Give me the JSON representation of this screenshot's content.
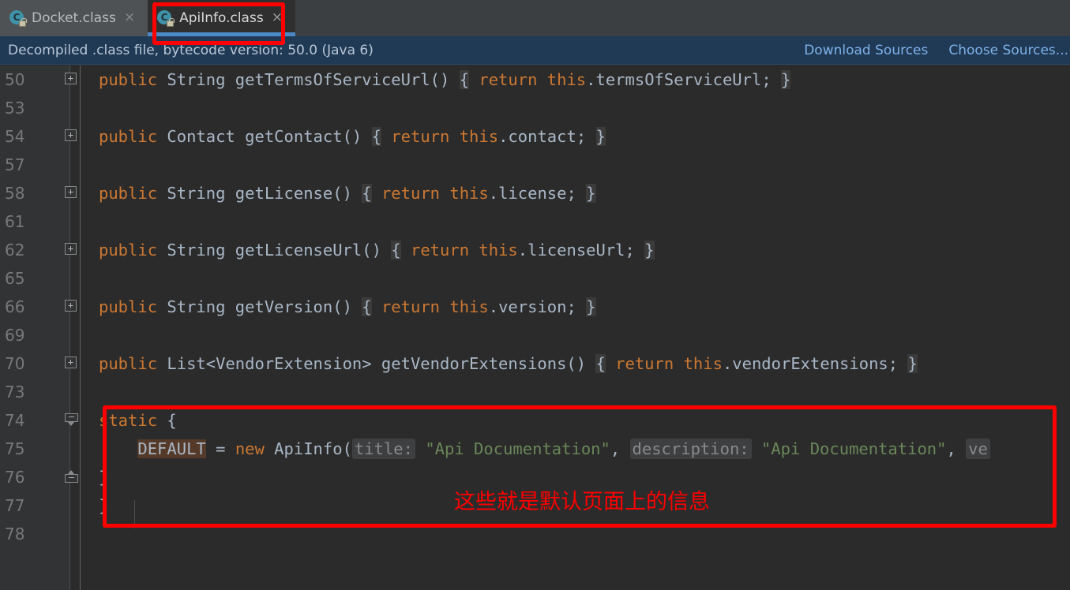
{
  "tabs": [
    {
      "label": "Docket.class",
      "icon": "java-class-icon",
      "close": "×",
      "active": false,
      "badge": "C"
    },
    {
      "label": "ApiInfo.class",
      "icon": "java-class-icon",
      "close": "×",
      "active": true,
      "badge": "C"
    }
  ],
  "notification": {
    "message": "Decompiled .class file, bytecode version: 50.0 (Java 6)",
    "download_sources": "Download Sources",
    "choose_sources": "Choose Sources..."
  },
  "editor": {
    "lines": [
      {
        "num": "50",
        "fold": "plus",
        "indent": 1,
        "tokens": [
          {
            "t": "public",
            "c": "kw"
          },
          {
            "t": " ",
            "c": "plain"
          },
          {
            "t": "String",
            "c": "cls"
          },
          {
            "t": " getTermsOfServiceUrl() ",
            "c": "plain"
          },
          {
            "t": "{",
            "c": "brace-hl"
          },
          {
            "t": " ",
            "c": "plain"
          },
          {
            "t": "return",
            "c": "kw"
          },
          {
            "t": " ",
            "c": "plain"
          },
          {
            "t": "this",
            "c": "kw"
          },
          {
            "t": ".termsOfServiceUrl; ",
            "c": "plain"
          },
          {
            "t": "}",
            "c": "brace-hl"
          }
        ]
      },
      {
        "num": "53",
        "fold": "none",
        "indent": 0,
        "tokens": []
      },
      {
        "num": "54",
        "fold": "plus",
        "indent": 1,
        "tokens": [
          {
            "t": "public",
            "c": "kw"
          },
          {
            "t": " ",
            "c": "plain"
          },
          {
            "t": "Contact",
            "c": "cls"
          },
          {
            "t": " getContact() ",
            "c": "plain"
          },
          {
            "t": "{",
            "c": "brace-hl"
          },
          {
            "t": " ",
            "c": "plain"
          },
          {
            "t": "return",
            "c": "kw"
          },
          {
            "t": " ",
            "c": "plain"
          },
          {
            "t": "this",
            "c": "kw"
          },
          {
            "t": ".contact; ",
            "c": "plain"
          },
          {
            "t": "}",
            "c": "brace-hl"
          }
        ]
      },
      {
        "num": "57",
        "fold": "none",
        "indent": 0,
        "tokens": []
      },
      {
        "num": "58",
        "fold": "plus",
        "indent": 1,
        "tokens": [
          {
            "t": "public",
            "c": "kw"
          },
          {
            "t": " ",
            "c": "plain"
          },
          {
            "t": "String",
            "c": "cls"
          },
          {
            "t": " getLicense() ",
            "c": "plain"
          },
          {
            "t": "{",
            "c": "brace-hl"
          },
          {
            "t": " ",
            "c": "plain"
          },
          {
            "t": "return",
            "c": "kw"
          },
          {
            "t": " ",
            "c": "plain"
          },
          {
            "t": "this",
            "c": "kw"
          },
          {
            "t": ".license; ",
            "c": "plain"
          },
          {
            "t": "}",
            "c": "brace-hl"
          }
        ]
      },
      {
        "num": "61",
        "fold": "none",
        "indent": 0,
        "tokens": []
      },
      {
        "num": "62",
        "fold": "plus",
        "indent": 1,
        "tokens": [
          {
            "t": "public",
            "c": "kw"
          },
          {
            "t": " ",
            "c": "plain"
          },
          {
            "t": "String",
            "c": "cls"
          },
          {
            "t": " getLicenseUrl() ",
            "c": "plain"
          },
          {
            "t": "{",
            "c": "brace-hl"
          },
          {
            "t": " ",
            "c": "plain"
          },
          {
            "t": "return",
            "c": "kw"
          },
          {
            "t": " ",
            "c": "plain"
          },
          {
            "t": "this",
            "c": "kw"
          },
          {
            "t": ".licenseUrl; ",
            "c": "plain"
          },
          {
            "t": "}",
            "c": "brace-hl"
          }
        ]
      },
      {
        "num": "65",
        "fold": "none",
        "indent": 0,
        "tokens": []
      },
      {
        "num": "66",
        "fold": "plus",
        "indent": 1,
        "tokens": [
          {
            "t": "public",
            "c": "kw"
          },
          {
            "t": " ",
            "c": "plain"
          },
          {
            "t": "String",
            "c": "cls"
          },
          {
            "t": " getVersion() ",
            "c": "plain"
          },
          {
            "t": "{",
            "c": "brace-hl"
          },
          {
            "t": " ",
            "c": "plain"
          },
          {
            "t": "return",
            "c": "kw"
          },
          {
            "t": " ",
            "c": "plain"
          },
          {
            "t": "this",
            "c": "kw"
          },
          {
            "t": ".version; ",
            "c": "plain"
          },
          {
            "t": "}",
            "c": "brace-hl"
          }
        ]
      },
      {
        "num": "69",
        "fold": "none",
        "indent": 0,
        "tokens": []
      },
      {
        "num": "70",
        "fold": "plus",
        "indent": 1,
        "tokens": [
          {
            "t": "public",
            "c": "kw"
          },
          {
            "t": " ",
            "c": "plain"
          },
          {
            "t": "List<VendorExtension>",
            "c": "cls"
          },
          {
            "t": " getVendorExtensions() ",
            "c": "plain"
          },
          {
            "t": "{",
            "c": "brace-hl"
          },
          {
            "t": " ",
            "c": "plain"
          },
          {
            "t": "return",
            "c": "kw"
          },
          {
            "t": " ",
            "c": "plain"
          },
          {
            "t": "this",
            "c": "kw"
          },
          {
            "t": ".vendorExtensions; ",
            "c": "plain"
          },
          {
            "t": "}",
            "c": "brace-hl"
          }
        ]
      },
      {
        "num": "73",
        "fold": "none",
        "indent": 0,
        "tokens": []
      },
      {
        "num": "74",
        "fold": "minus-open",
        "indent": 1,
        "tokens": [
          {
            "t": "static",
            "c": "kw"
          },
          {
            "t": " {",
            "c": "plain"
          }
        ]
      },
      {
        "num": "75",
        "fold": "none",
        "indent": 2,
        "tokens": [
          {
            "t": "    ",
            "c": "plain"
          },
          {
            "t": "DEFAULT",
            "c": "ident-hl"
          },
          {
            "t": " = ",
            "c": "plain"
          },
          {
            "t": "new",
            "c": "kw"
          },
          {
            "t": " ApiInfo(",
            "c": "plain"
          },
          {
            "t": "title:",
            "c": "param-hint"
          },
          {
            "t": " ",
            "c": "plain"
          },
          {
            "t": "\"Api Documentation\"",
            "c": "str"
          },
          {
            "t": ", ",
            "c": "plain"
          },
          {
            "t": "description:",
            "c": "param-hint"
          },
          {
            "t": " ",
            "c": "plain"
          },
          {
            "t": "\"Api Documentation\"",
            "c": "str"
          },
          {
            "t": ", ",
            "c": "plain"
          },
          {
            "t": "ve",
            "c": "param-hint"
          }
        ]
      },
      {
        "num": "76",
        "fold": "minus-end",
        "indent": 1,
        "tokens": [
          {
            "t": "}",
            "c": "plain"
          }
        ]
      },
      {
        "num": "77",
        "fold": "none",
        "indent": 0,
        "tokens": [
          {
            "t": "}",
            "c": "plain"
          }
        ]
      },
      {
        "num": "78",
        "fold": "none",
        "indent": 0,
        "tokens": []
      }
    ]
  },
  "annotations": {
    "tab_highlight": {
      "name": "red-rectangle-around-apiinfo-tab",
      "color": "#fe0000"
    },
    "static_block_highlight": {
      "name": "red-rectangle-around-static-block",
      "color": "#fe0000"
    },
    "note": {
      "text": "这些就是默认页面上的信息",
      "color": "#fe0000"
    }
  },
  "colors": {
    "editor_bg": "#2b2b2b",
    "gutter_bg": "#313335",
    "tabbar_bg": "#3c3f41",
    "notification_bg": "#203a56",
    "keyword": "#cc7832",
    "string": "#6a8759",
    "text": "#a9b7c6",
    "annotation_red": "#fe0000",
    "active_tab_underline": "#4a88c7",
    "link": "#7eb1e8"
  }
}
